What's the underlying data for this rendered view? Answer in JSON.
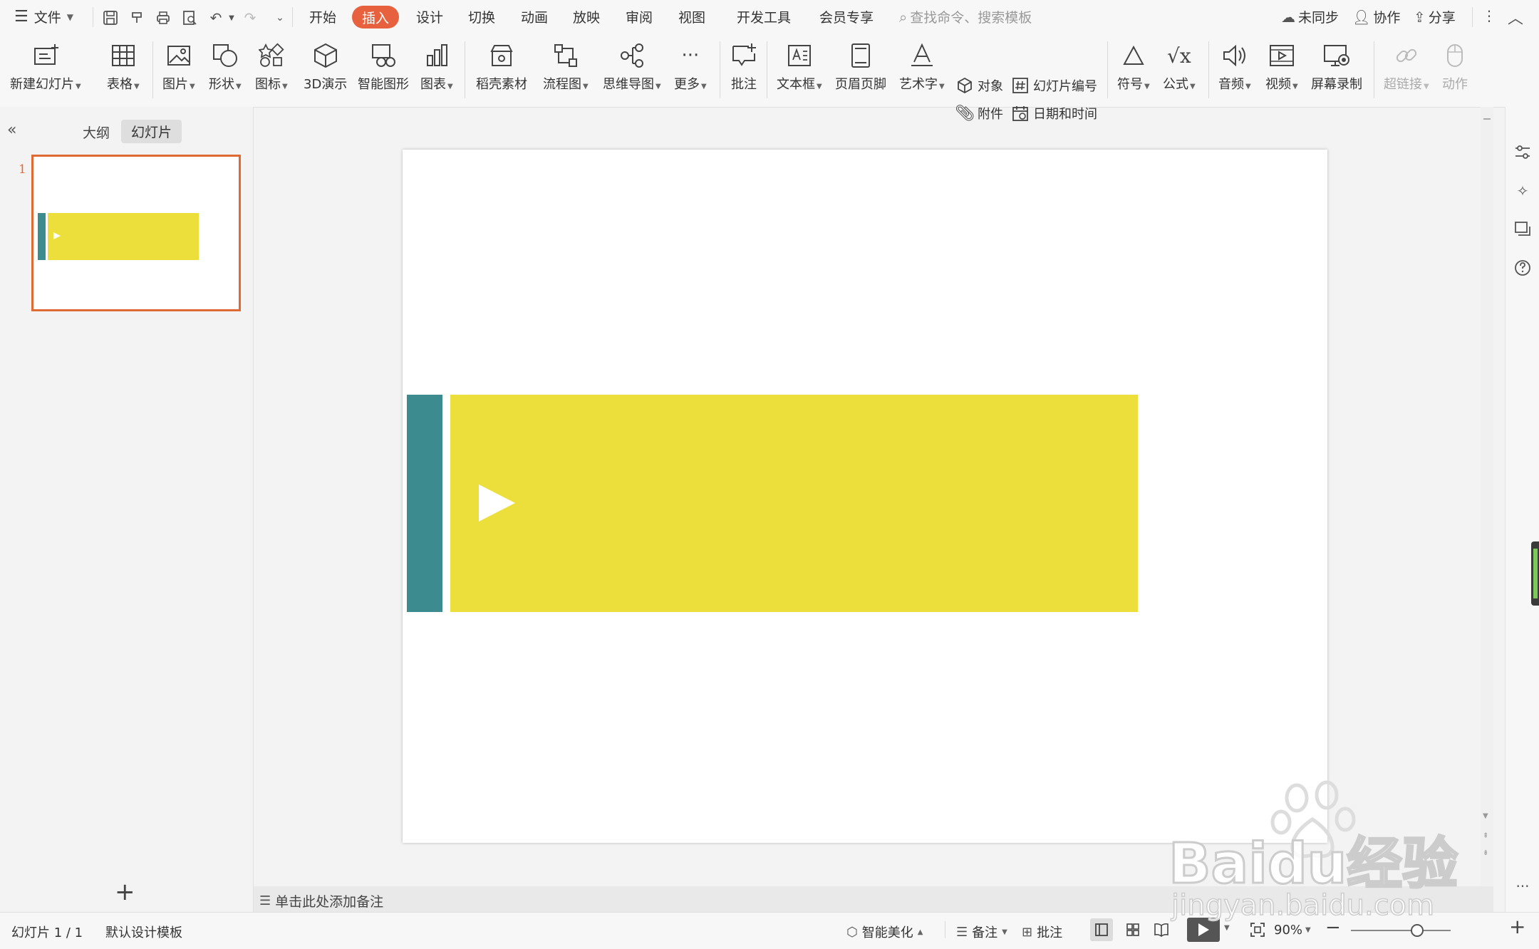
{
  "menubar": {
    "file_label": "文件",
    "tabs": [
      "开始",
      "插入",
      "设计",
      "切换",
      "动画",
      "放映",
      "审阅",
      "视图",
      "开发工具",
      "会员专享"
    ],
    "search_placeholder": "查找命令、搜索模板",
    "sync_label": "未同步",
    "collab_label": "协作",
    "share_label": "分享"
  },
  "ribbon": {
    "new_slide": "新建幻灯片",
    "table": "表格",
    "picture": "图片",
    "shape": "形状",
    "icon": "图标",
    "demo3d": "3D演示",
    "smartart": "智能图形",
    "chart": "图表",
    "material": "稻壳素材",
    "flowchart": "流程图",
    "mindmap": "思维导图",
    "more": "更多",
    "comment": "批注",
    "textbox": "文本框",
    "header_footer": "页眉页脚",
    "wordart": "艺术字",
    "object": "对象",
    "slide_number": "幻灯片编号",
    "attachment": "附件",
    "datetime": "日期和时间",
    "symbol": "符号",
    "formula": "公式",
    "audio": "音频",
    "video": "视频",
    "screen_record": "屏幕录制",
    "hyperlink": "超链接",
    "action": "动作"
  },
  "leftpanel": {
    "outline_tab": "大纲",
    "slides_tab": "幻灯片",
    "slide_number": "1"
  },
  "colors": {
    "accent": "#e8613f",
    "teal": "#3c8b8f",
    "yellow": "#ecdf3c",
    "thumb_border": "#e06a34"
  },
  "notes": {
    "placeholder": "单击此处添加备注"
  },
  "statusbar": {
    "slide_info": "幻灯片 1 / 1",
    "template": "默认设计模板",
    "beautify": "智能美化",
    "notes": "备注",
    "comment": "批注",
    "zoom": "90%"
  },
  "watermark": {
    "line1": "Baidu经验",
    "line2": "jingyan.baidu.com"
  }
}
